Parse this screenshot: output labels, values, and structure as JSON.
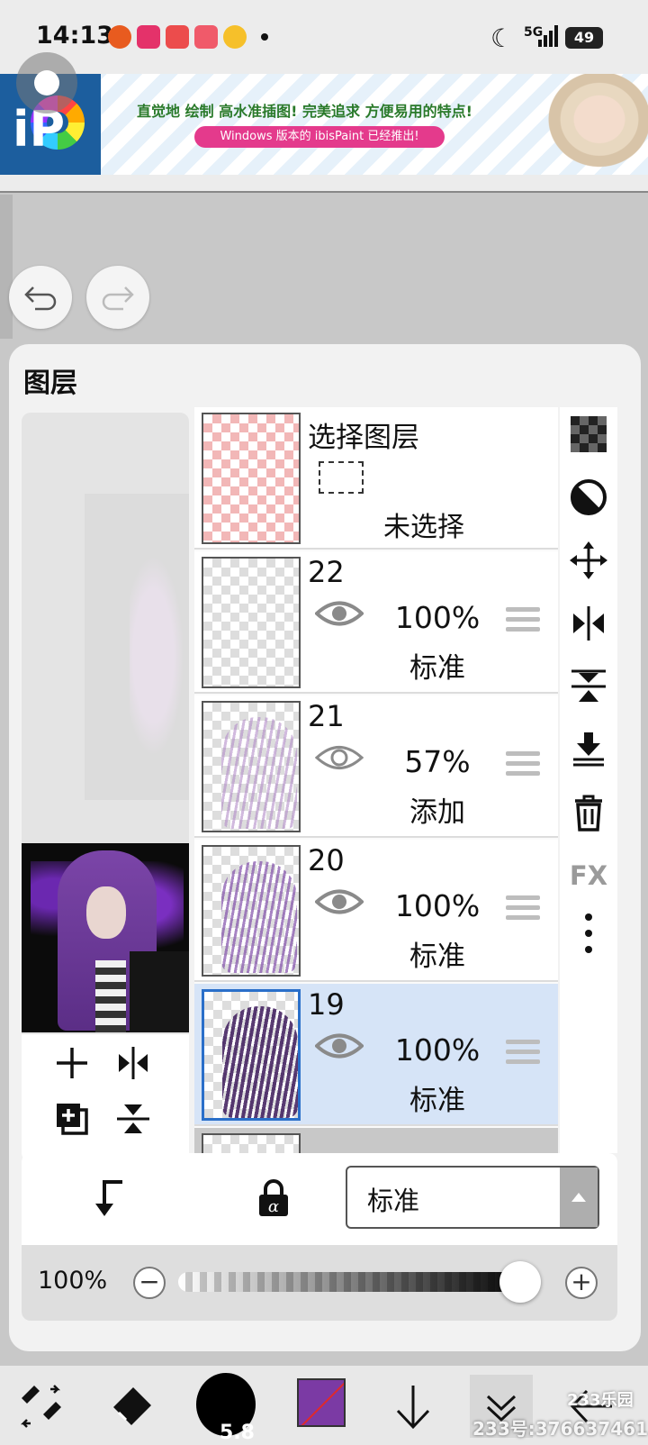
{
  "status_bar": {
    "time": "14:13",
    "network": "5G",
    "battery": "49"
  },
  "ad": {
    "headline": "直觉地 绘制 高水准插图! 完美追求 方便易用的特点!",
    "pill": "Windows 版本的 ibisPaint 已经推出!",
    "logo_text": "iP"
  },
  "panel": {
    "title": "图层",
    "selection_layer": {
      "title": "选择图层",
      "status": "未选择"
    },
    "layers": [
      {
        "number": "22",
        "opacity": "100%",
        "blend": "标准",
        "visible": true,
        "selected": false
      },
      {
        "number": "21",
        "opacity": "57%",
        "blend": "添加",
        "visible": true,
        "selected": false
      },
      {
        "number": "20",
        "opacity": "100%",
        "blend": "标准",
        "visible": true,
        "selected": false
      },
      {
        "number": "19",
        "opacity": "100%",
        "blend": "标准",
        "visible": true,
        "selected": true
      }
    ],
    "blend_mode_select": "标准",
    "opacity_label": "100%",
    "opacity_value": 1.0,
    "side_tools": [
      "checker-icon",
      "contrast-icon",
      "move-icon",
      "flip-horizontal-icon",
      "flip-vertical-icon",
      "merge-down-icon",
      "trash-icon",
      "fx-icon",
      "more-icon"
    ],
    "fx_label": "FX"
  },
  "toolbar": {
    "brush_size": "5.8",
    "color": "#7b3aa4"
  },
  "watermark": {
    "text": "233号:376637461",
    "logo": "233乐园"
  }
}
